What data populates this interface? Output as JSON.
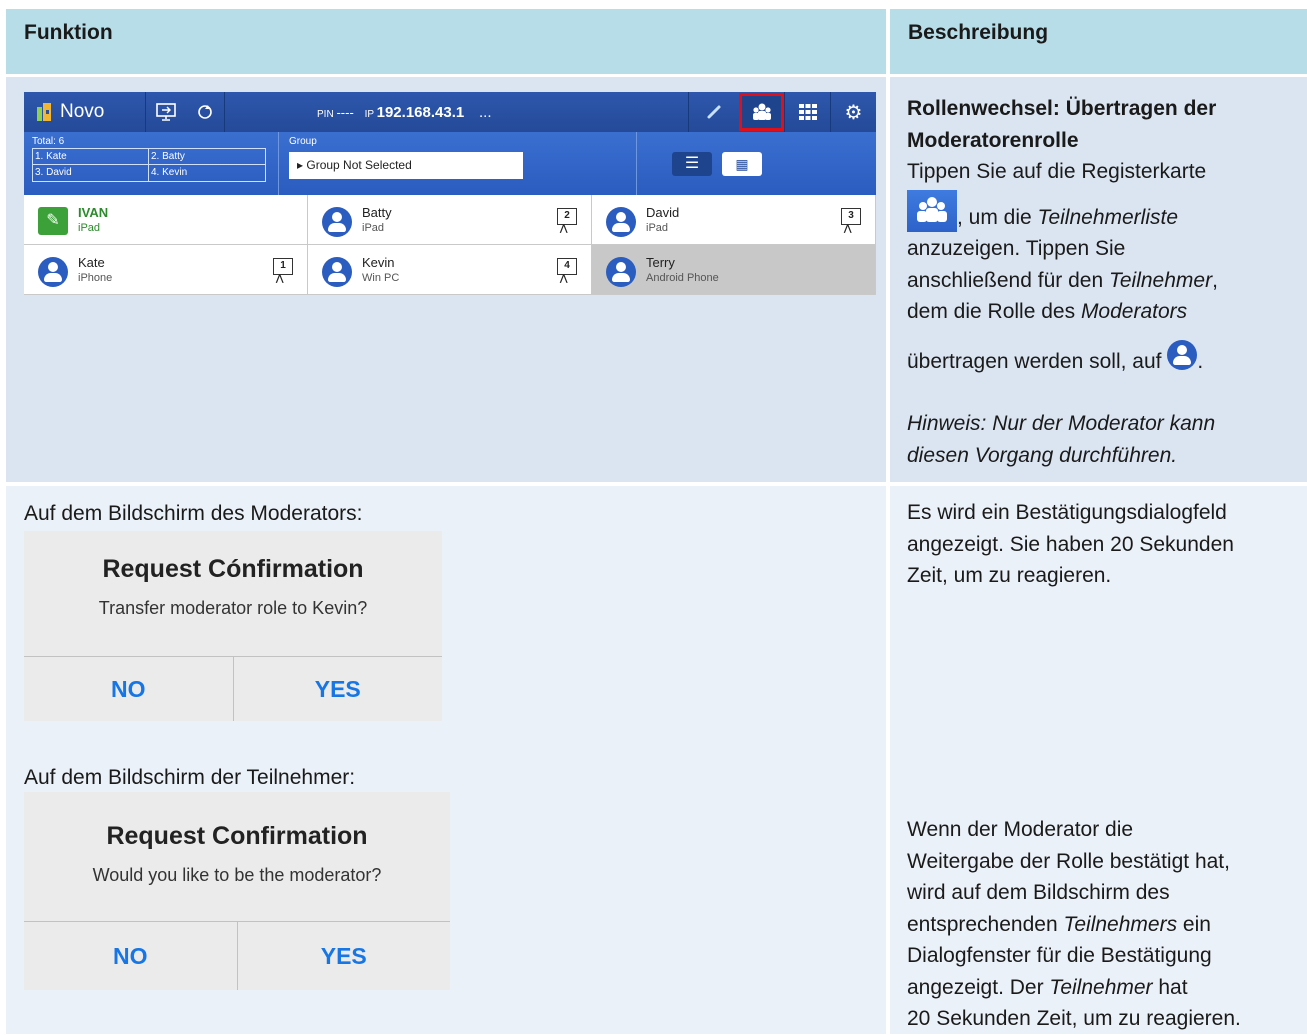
{
  "table": {
    "header_left": "Funktion",
    "header_right": "Beschreibung"
  },
  "novo": {
    "app_name": "Novo",
    "pin_label": "PIN",
    "pin_value": "----",
    "ip_label": "IP",
    "ip_value": "192.168.43.1",
    "more": "...",
    "total_label": "Total: 6",
    "roster": [
      "1. Kate",
      "2. Batty",
      "3. David",
      "4. Kevin"
    ],
    "group_label": "Group",
    "group_value": "Group Not Selected",
    "participants": [
      {
        "name": "IVAN",
        "device": "iPad",
        "slot": ""
      },
      {
        "name": "Batty",
        "device": "iPad",
        "slot": "2"
      },
      {
        "name": "David",
        "device": "iPad",
        "slot": "3"
      },
      {
        "name": "Kate",
        "device": "iPhone",
        "slot": "1"
      },
      {
        "name": "Kevin",
        "device": "Win PC",
        "slot": "4"
      },
      {
        "name": "Terry",
        "device": "Android Phone",
        "slot": ""
      }
    ],
    "highlight_color": "#e0101a"
  },
  "row1": {
    "title": "Rollenwechsel: Übertragen der Moderatorenrolle",
    "t1": "Tippen Sie auf die Registerkarte",
    "t2": ", um die ",
    "t2i": "Teilnehmerliste",
    "t3": "anzuzeigen. Tippen Sie",
    "t4": "anschließend für den ",
    "t4i": "Teilnehmer",
    "t4e": ",",
    "t5": "dem die Rolle des ",
    "t5i": "Moderators",
    "t6": "übertragen werden soll, auf",
    "t6e": ".",
    "note1": "Hinweis: Nur der Moderator kann",
    "note2": "diesen Vorgang durchführen."
  },
  "row2": {
    "mod_caption": "Auf dem Bildschirm des Moderators:",
    "part_caption": "Auf dem Bildschirm der Teilnehmer:",
    "dlg1_title": "Request Cónfirmation",
    "dlg1_msg": "Transfer moderator role to Kevin?",
    "dlg2_title": "Request Confirmation",
    "dlg2_msg": "Would you like to be the moderator?",
    "no": "NO",
    "yes": "YES",
    "desc1_l1": "Es wird ein Bestätigungsdialogfeld",
    "desc1_l2": "angezeigt. Sie haben 20 Sekunden",
    "desc1_l3": "Zeit, um zu reagieren.",
    "desc2_l1": "Wenn der Moderator die",
    "desc2_l2": "Weitergabe der Rolle bestätigt hat,",
    "desc2_l3": "wird auf dem Bildschirm des",
    "desc2_l4a": "entsprechenden ",
    "desc2_l4i": "Teilnehmers",
    "desc2_l4b": " ein",
    "desc2_l5": "Dialogfenster für die Bestätigung",
    "desc2_l6a": "angezeigt. Der ",
    "desc2_l6i": "Teilnehmer",
    "desc2_l6b": " hat",
    "desc2_l7": "20 Sekunden Zeit, um zu reagieren."
  }
}
